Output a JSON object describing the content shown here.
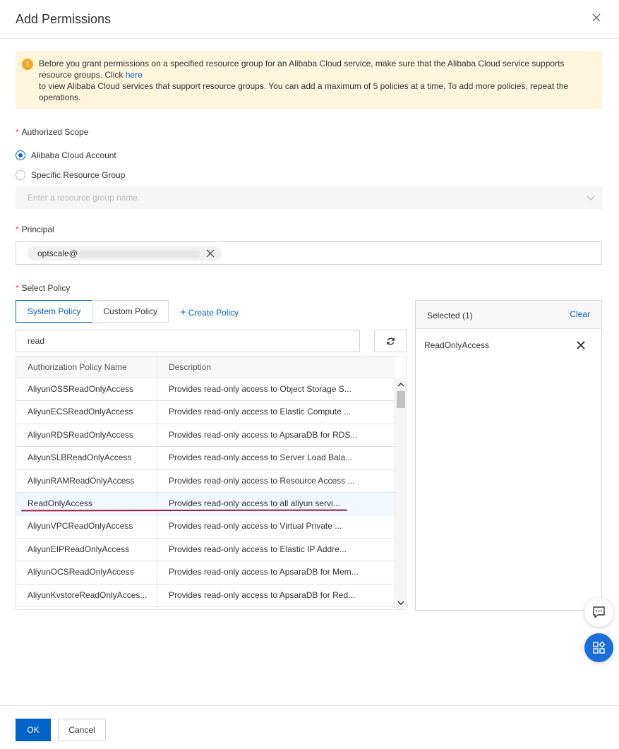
{
  "dialog": {
    "title": "Add Permissions"
  },
  "notice": {
    "text_before": "Before you grant permissions on a specified resource group for an Alibaba Cloud service, make sure that the Alibaba Cloud service supports resource groups. Click ",
    "link": "here",
    "text_after": "to view Alibaba Cloud services that support resource groups. You can add a maximum of 5 policies at a time. To add more policies, repeat the operations."
  },
  "scope": {
    "label": "Authorized Scope",
    "options": [
      {
        "label": "Alibaba Cloud Account",
        "selected": true
      },
      {
        "label": "Specific Resource Group",
        "selected": false
      }
    ],
    "resource_group_placeholder": "Enter a resource group name."
  },
  "principal": {
    "label": "Principal",
    "tag": "optscale@"
  },
  "policy": {
    "label": "Select Policy",
    "tabs": [
      "System Policy",
      "Custom Policy"
    ],
    "active_tab": "System Policy",
    "create_label": "Create Policy",
    "search_value": "read",
    "columns": [
      "Authorization Policy Name",
      "Description"
    ],
    "rows": [
      {
        "name": "AliyunOSSReadOnlyAccess",
        "desc": "Provides read-only access to Object Storage S..."
      },
      {
        "name": "AliyunECSReadOnlyAccess",
        "desc": "Provides read-only access to Elastic Compute ..."
      },
      {
        "name": "AliyunRDSReadOnlyAccess",
        "desc": "Provides read-only access to ApsaraDB for RDS..."
      },
      {
        "name": "AliyunSLBReadOnlyAccess",
        "desc": "Provides read-only access to Server Load Bala..."
      },
      {
        "name": "AliyunRAMReadOnlyAccess",
        "desc": "Provides read-only access to Resource Access ..."
      },
      {
        "name": "ReadOnlyAccess",
        "desc": "Provides read-only access to all aliyun servi..."
      },
      {
        "name": "AliyunVPCReadOnlyAccess",
        "desc": "Provides read-only access to Virtual Private ..."
      },
      {
        "name": "AliyunEIPReadOnlyAccess",
        "desc": "Provides read-only access to Elastic IP Addre..."
      },
      {
        "name": "AliyunOCSReadOnlyAccess",
        "desc": "Provides read-only access to ApsaraDB for Mem..."
      },
      {
        "name": "AliyunKvstoreReadOnlyAcces...",
        "desc": "Provides read-only access to ApsaraDB for Red..."
      }
    ]
  },
  "selected": {
    "title": "Selected (1)",
    "clear_label": "Clear",
    "items": [
      "ReadOnlyAccess"
    ]
  },
  "footer": {
    "ok_label": "OK",
    "cancel_label": "Cancel"
  },
  "colors": {
    "primary": "#0064c8",
    "notice_bg": "#fdf5dc",
    "warning": "#f5a623",
    "required": "#e34d59",
    "annotation_line": "#9c1c3c"
  }
}
